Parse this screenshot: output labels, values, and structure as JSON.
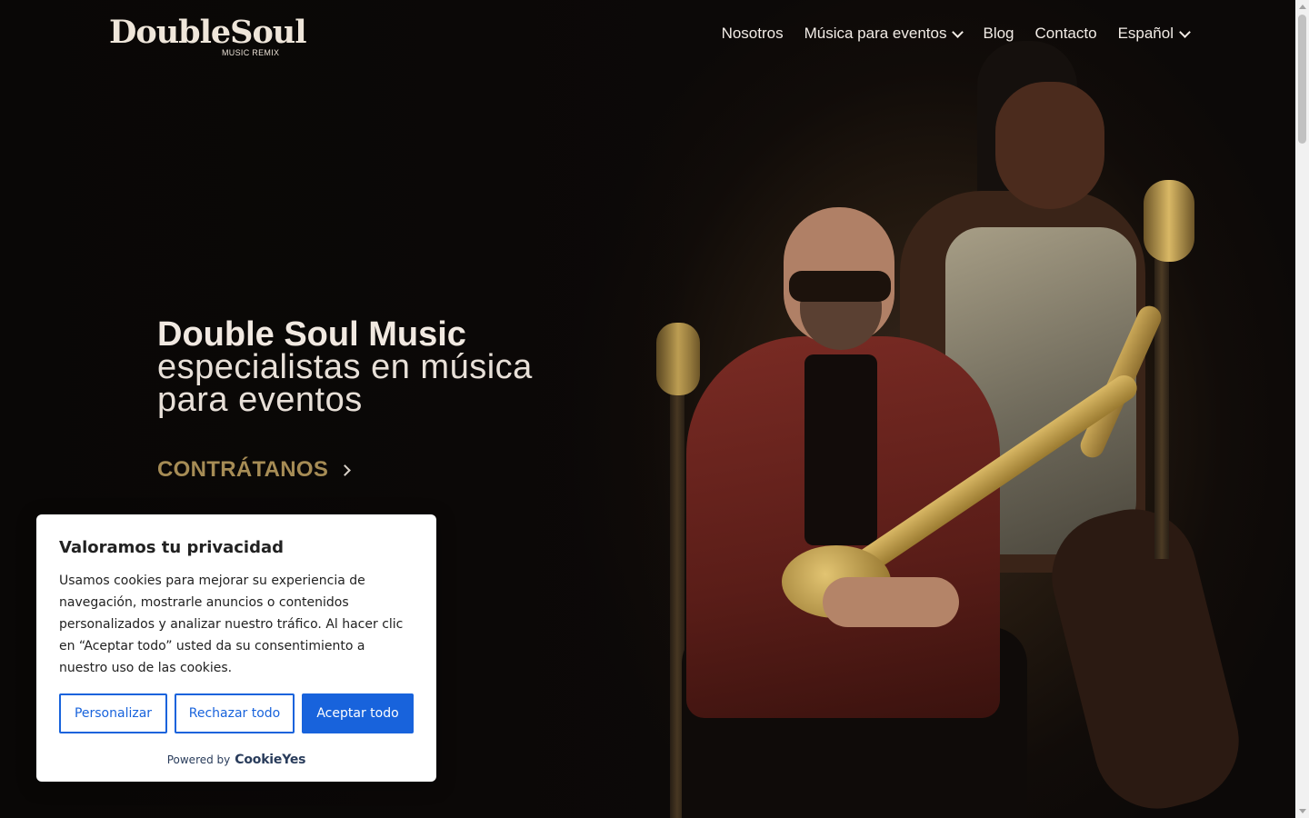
{
  "header": {
    "logo_main": "DoubleSoul",
    "logo_sub": "MUSIC REMIX",
    "nav": [
      {
        "label": "Nosotros",
        "has_dropdown": false
      },
      {
        "label": "Música para eventos",
        "has_dropdown": true
      },
      {
        "label": "Blog",
        "has_dropdown": false
      },
      {
        "label": "Contacto",
        "has_dropdown": false
      },
      {
        "label": "Español",
        "has_dropdown": true
      }
    ]
  },
  "hero": {
    "title": "Double Soul Music",
    "subtitle": "especialistas en música para eventos",
    "cta_label": "CONTRÁTANOS",
    "cta_color": "#a68c55"
  },
  "cookie_banner": {
    "title": "Valoramos tu privacidad",
    "text": "Usamos cookies para mejorar su experiencia de navegación, mostrarle anuncios o contenidos personalizados y analizar nuestro tráfico. Al hacer clic en “Aceptar todo” usted da su consentimiento a nuestro uso de las cookies.",
    "buttons": {
      "customize": "Personalizar",
      "reject": "Rechazar todo",
      "accept": "Aceptar todo"
    },
    "powered_by": "Powered by",
    "brand": "CookieYes",
    "accent": "#1863dc"
  },
  "icons": {
    "dropdown": "chevron-down-icon",
    "cta_arrow": "chevron-right-icon"
  }
}
